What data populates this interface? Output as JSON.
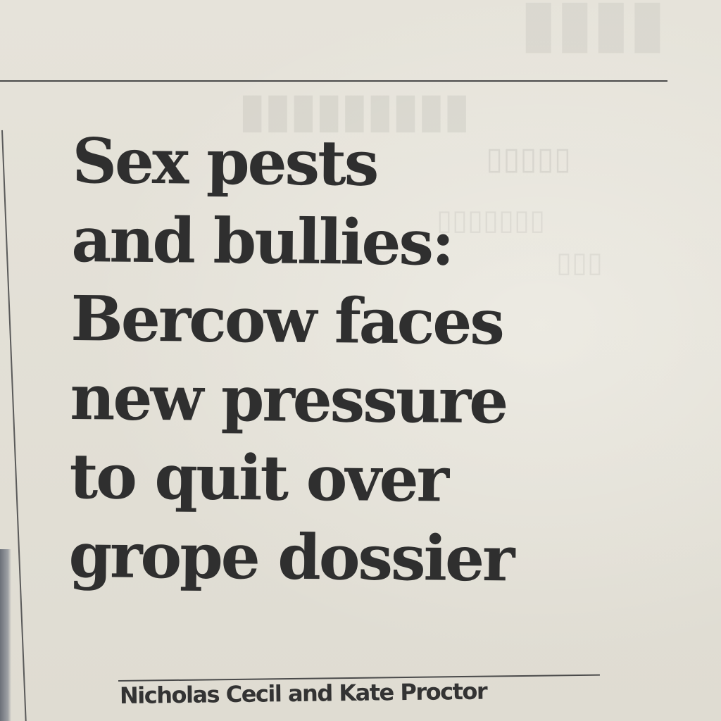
{
  "article": {
    "headline_lines": [
      "Sex pests",
      "and bullies:",
      "Bercow faces",
      "new pressure",
      "to quit over",
      "grope dossier"
    ],
    "byline": "Nicholas Cecil and Kate Proctor"
  },
  "colors": {
    "paper": "#e3e0d7",
    "ink": "#2f2f2f",
    "rule": "#4a4a4a"
  }
}
